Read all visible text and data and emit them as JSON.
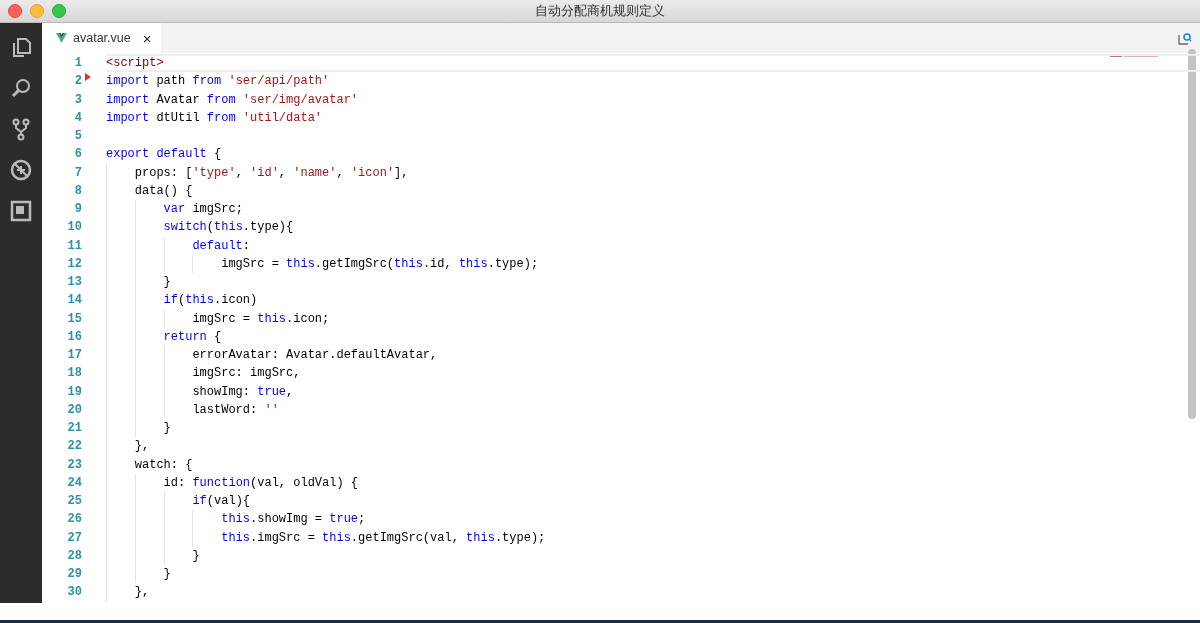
{
  "window": {
    "title": "自动分配商机规则定义"
  },
  "activity_bar": [
    {
      "kind": "files",
      "selected": false
    },
    {
      "kind": "search",
      "selected": false
    },
    {
      "kind": "git",
      "selected": false
    },
    {
      "kind": "debug",
      "selected": false
    },
    {
      "kind": "extensions",
      "selected": false
    }
  ],
  "tabs": [
    {
      "label": "avatar.vue",
      "selected": true,
      "close": "×"
    }
  ],
  "editor": {
    "lines": [
      {
        "number": "1",
        "current": true,
        "tokens": [
          {
            "kind": "tag",
            "text": "<script>"
          }
        ]
      },
      {
        "number": "2",
        "current": false,
        "tokens": [
          {
            "kind": "kw",
            "text": "import"
          },
          {
            "kind": "plain",
            "text": " path "
          },
          {
            "kind": "kw",
            "text": "from"
          },
          {
            "kind": "str",
            "text": " 'ser/api/path'"
          }
        ]
      },
      {
        "number": "3",
        "current": false,
        "tokens": [
          {
            "kind": "kw",
            "text": "import"
          },
          {
            "kind": "plain",
            "text": " Avatar "
          },
          {
            "kind": "kw",
            "text": "from"
          },
          {
            "kind": "str",
            "text": " 'ser/img/avatar'"
          }
        ]
      },
      {
        "number": "4",
        "current": false,
        "tokens": [
          {
            "kind": "kw",
            "text": "import"
          },
          {
            "kind": "plain",
            "text": " dtUtil "
          },
          {
            "kind": "kw",
            "text": "from"
          },
          {
            "kind": "str",
            "text": " 'util/data'"
          }
        ]
      },
      {
        "number": "5",
        "current": false
      },
      {
        "number": "6",
        "current": false,
        "tokens": [
          {
            "kind": "kw",
            "text": "export default"
          },
          {
            "kind": "plain",
            "text": " {"
          }
        ]
      },
      {
        "number": "7",
        "current": false,
        "tokens": [
          {
            "kind": "plain",
            "text": "    props: ["
          },
          {
            "kind": "str",
            "text": "'type'"
          },
          {
            "kind": "plain",
            "text": ", "
          },
          {
            "kind": "str",
            "text": "'id'"
          },
          {
            "kind": "plain",
            "text": ", "
          },
          {
            "kind": "str",
            "text": "'name'"
          },
          {
            "kind": "plain",
            "text": ", "
          },
          {
            "kind": "str",
            "text": "'icon'"
          },
          {
            "kind": "plain",
            "text": "],"
          }
        ]
      },
      {
        "number": "8",
        "current": false,
        "tokens": [
          {
            "kind": "plain",
            "text": "    data() {"
          }
        ]
      },
      {
        "number": "9",
        "current": false,
        "tokens": [
          {
            "kind": "kw",
            "text": "        var"
          },
          {
            "kind": "plain",
            "text": " imgSrc;"
          }
        ]
      },
      {
        "number": "10",
        "current": false,
        "tokens": [
          {
            "kind": "kw",
            "text": "        switch"
          },
          {
            "kind": "plain",
            "text": "("
          },
          {
            "kind": "kw",
            "text": "this"
          },
          {
            "kind": "plain",
            "text": ".type){"
          }
        ]
      },
      {
        "number": "11",
        "current": false,
        "tokens": [
          {
            "kind": "kw",
            "text": "            default"
          },
          {
            "kind": "plain",
            "text": ":"
          }
        ]
      },
      {
        "number": "12",
        "current": false,
        "tokens": [
          {
            "kind": "plain",
            "text": "                imgSrc = "
          },
          {
            "kind": "kw",
            "text": "this"
          },
          {
            "kind": "plain",
            "text": ".getImgSrc("
          },
          {
            "kind": "kw",
            "text": "this"
          },
          {
            "kind": "plain",
            "text": ".id, "
          },
          {
            "kind": "kw",
            "text": "this"
          },
          {
            "kind": "plain",
            "text": ".type);"
          }
        ]
      },
      {
        "number": "13",
        "current": false,
        "tokens": [
          {
            "kind": "plain",
            "text": "        }"
          }
        ]
      },
      {
        "number": "14",
        "current": false,
        "tokens": [
          {
            "kind": "kw",
            "text": "        if"
          },
          {
            "kind": "plain",
            "text": "("
          },
          {
            "kind": "kw",
            "text": "this"
          },
          {
            "kind": "plain",
            "text": ".icon)"
          }
        ]
      },
      {
        "number": "15",
        "current": false,
        "tokens": [
          {
            "kind": "plain",
            "text": "            imgSrc = "
          },
          {
            "kind": "kw",
            "text": "this"
          },
          {
            "kind": "plain",
            "text": ".icon;"
          }
        ]
      },
      {
        "number": "16",
        "current": false,
        "tokens": [
          {
            "kind": "kw",
            "text": "        return"
          },
          {
            "kind": "plain",
            "text": " {"
          }
        ]
      },
      {
        "number": "17",
        "current": false,
        "tokens": [
          {
            "kind": "plain",
            "text": "            errorAvatar: Avatar.defaultAvatar,"
          }
        ]
      },
      {
        "number": "18",
        "current": false,
        "tokens": [
          {
            "kind": "plain",
            "text": "            imgSrc: imgSrc,"
          }
        ]
      },
      {
        "number": "19",
        "current": false,
        "tokens": [
          {
            "kind": "plain",
            "text": "            showImg: "
          },
          {
            "kind": "kw",
            "text": "true"
          },
          {
            "kind": "plain",
            "text": ","
          }
        ]
      },
      {
        "number": "20",
        "current": false,
        "tokens": [
          {
            "kind": "plain",
            "text": "            lastWord: "
          },
          {
            "kind": "str",
            "text": "''"
          }
        ]
      },
      {
        "number": "21",
        "current": false,
        "tokens": [
          {
            "kind": "plain",
            "text": "        }"
          }
        ]
      },
      {
        "number": "22",
        "current": false,
        "tokens": [
          {
            "kind": "plain",
            "text": "    },"
          }
        ]
      },
      {
        "number": "23",
        "current": false,
        "tokens": [
          {
            "kind": "plain",
            "text": "    watch: {"
          }
        ]
      },
      {
        "number": "24",
        "current": false,
        "tokens": [
          {
            "kind": "plain",
            "text": "        id: "
          },
          {
            "kind": "kw",
            "text": "function"
          },
          {
            "kind": "plain",
            "text": "(val, oldVal) {"
          }
        ]
      },
      {
        "number": "25",
        "current": false,
        "tokens": [
          {
            "kind": "kw",
            "text": "            if"
          },
          {
            "kind": "plain",
            "text": "(val){"
          }
        ]
      },
      {
        "number": "26",
        "current": false,
        "tokens": [
          {
            "kind": "kw",
            "text": "                this"
          },
          {
            "kind": "plain",
            "text": ".showImg = "
          },
          {
            "kind": "kw",
            "text": "true"
          },
          {
            "kind": "plain",
            "text": ";"
          }
        ]
      },
      {
        "number": "27",
        "current": false,
        "tokens": [
          {
            "kind": "kw",
            "text": "                this"
          },
          {
            "kind": "plain",
            "text": ".imgSrc = "
          },
          {
            "kind": "kw",
            "text": "this"
          },
          {
            "kind": "plain",
            "text": ".getImgSrc(val, "
          },
          {
            "kind": "kw",
            "text": "this"
          },
          {
            "kind": "plain",
            "text": ".type);"
          }
        ]
      },
      {
        "number": "28",
        "current": false,
        "tokens": [
          {
            "kind": "plain",
            "text": "            }"
          }
        ]
      },
      {
        "number": "29",
        "current": false,
        "tokens": [
          {
            "kind": "plain",
            "text": "        }"
          }
        ]
      },
      {
        "number": "30",
        "current": false,
        "tokens": [
          {
            "kind": "plain",
            "text": "    },"
          }
        ]
      }
    ]
  }
}
